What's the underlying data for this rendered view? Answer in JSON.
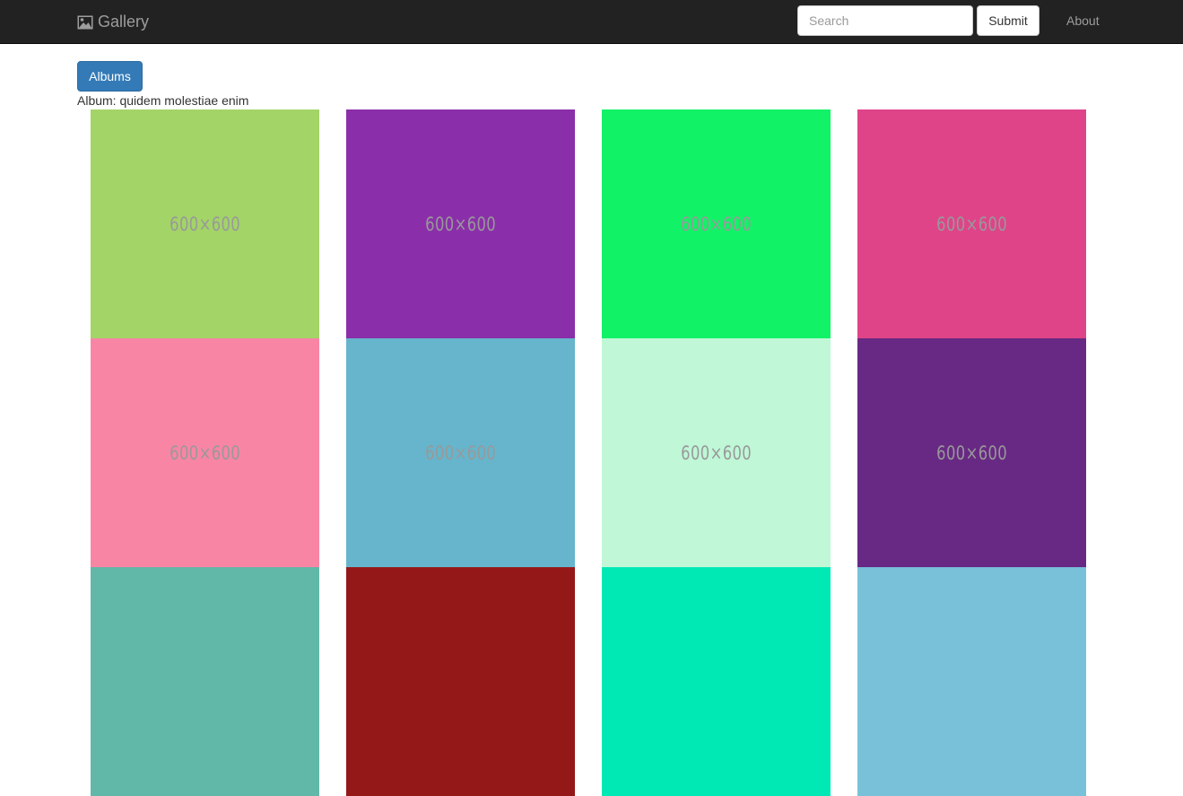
{
  "navbar": {
    "brand": {
      "icon": "picture-icon",
      "label": "Gallery"
    },
    "search": {
      "placeholder": "Search",
      "value": ""
    },
    "submit_label": "Submit",
    "about_label": "About"
  },
  "albums_button_label": "Albums",
  "album_caption": "Album: quidem molestiae enim",
  "photos": [
    {
      "label": "600×600",
      "color": "#a3d467"
    },
    {
      "label": "600×600",
      "color": "#8a2fa9"
    },
    {
      "label": "600×600",
      "color": "#12f267"
    },
    {
      "label": "600×600",
      "color": "#df4489"
    },
    {
      "label": "600×600",
      "color": "#f985a5"
    },
    {
      "label": "600×600",
      "color": "#66b5cc"
    },
    {
      "label": "600×600",
      "color": "#bff7d7"
    },
    {
      "label": "600×600",
      "color": "#682984"
    },
    {
      "label": "",
      "color": "#62b8a8"
    },
    {
      "label": "",
      "color": "#951819"
    },
    {
      "label": "",
      "color": "#00e9b5"
    },
    {
      "label": "",
      "color": "#78c1d9"
    }
  ]
}
